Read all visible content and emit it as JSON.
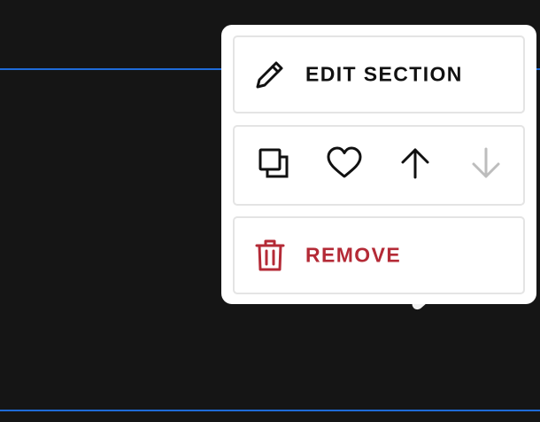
{
  "menu": {
    "edit_label": "EDIT SECTION",
    "remove_label": "REMOVE",
    "icons": {
      "edit": "pencil-icon",
      "duplicate": "duplicate-icon",
      "favorite": "heart-icon",
      "move_up": "arrow-up-icon",
      "move_down": "arrow-down-icon",
      "remove": "trash-icon"
    }
  },
  "colors": {
    "background": "#151515",
    "guide_line": "#1f6bd8",
    "popover": "#ffffff",
    "card_border": "#e4e4e4",
    "text": "#111111",
    "danger": "#b42a36",
    "disabled_icon": "#bdbdbd"
  }
}
